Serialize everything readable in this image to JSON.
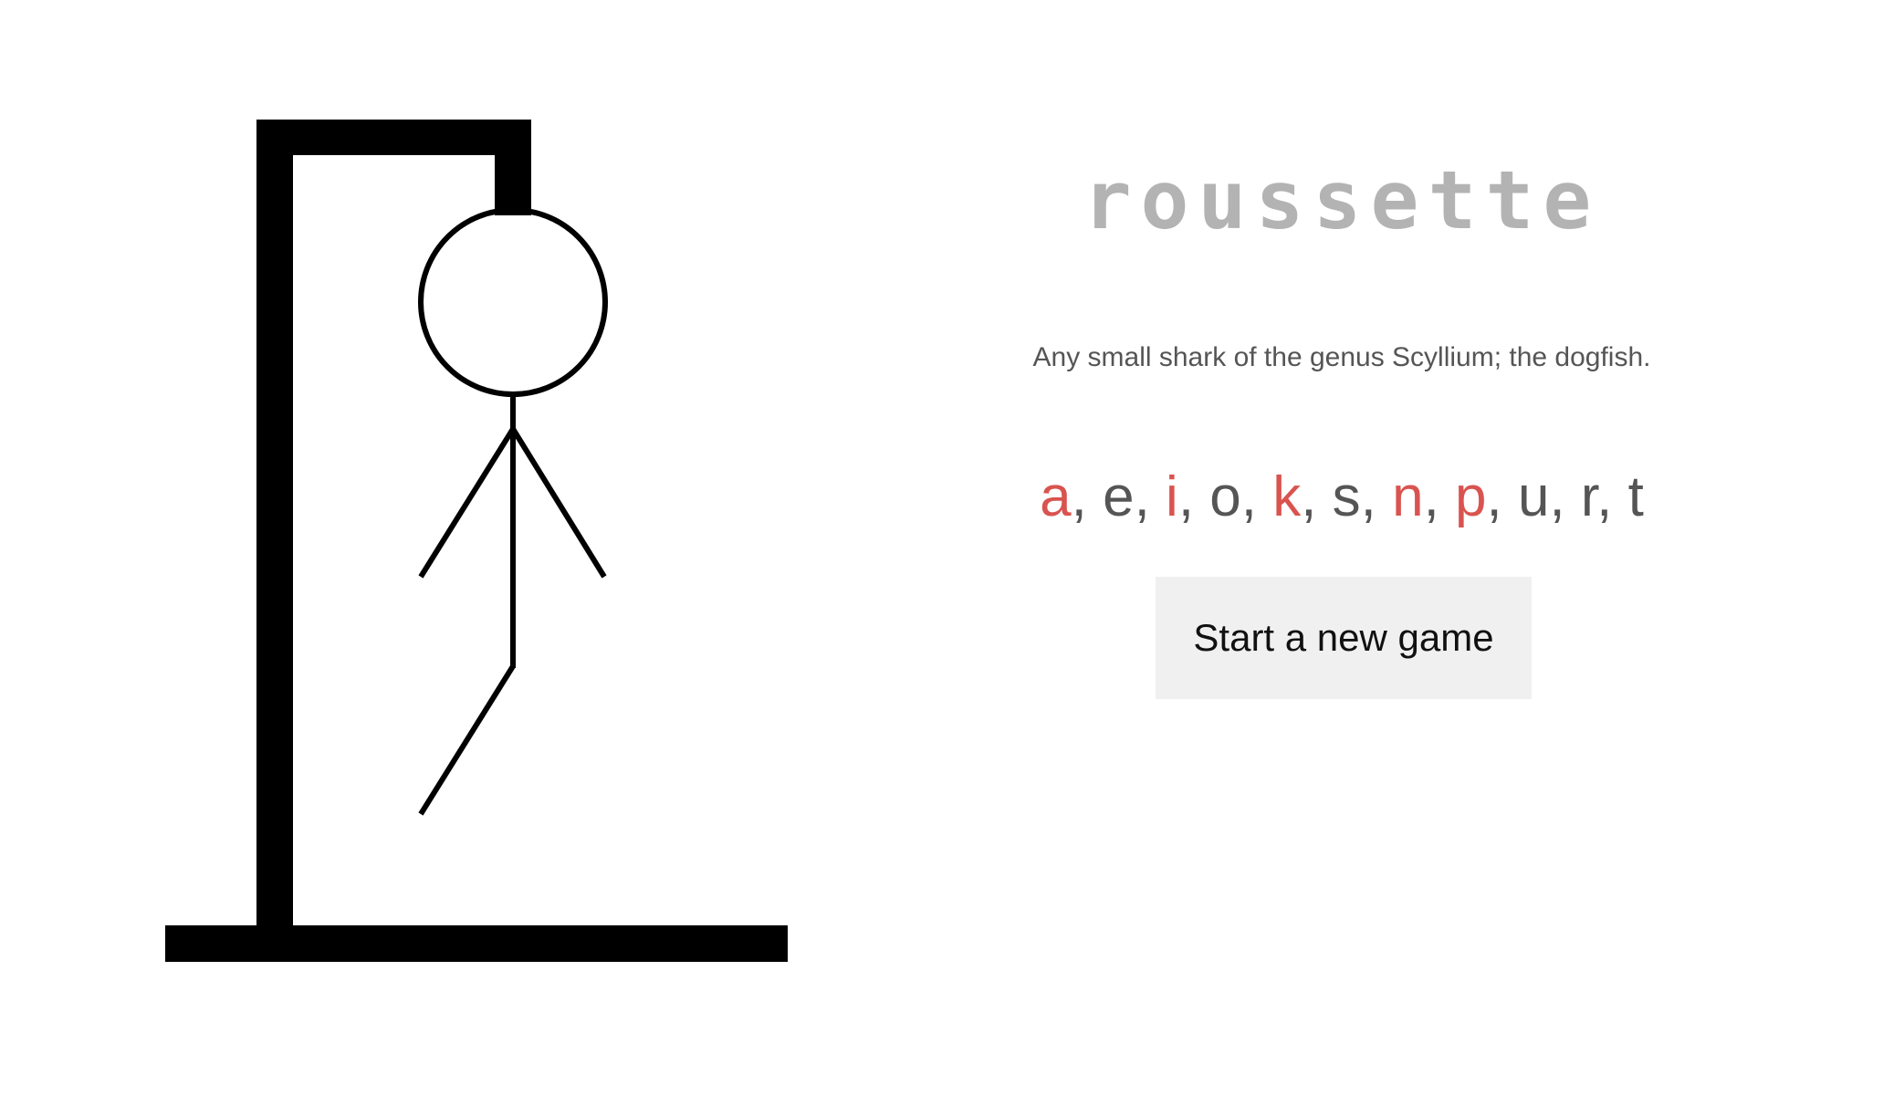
{
  "game": {
    "word": "roussette",
    "definition": "Any small shark of the genus Scyllium; the dogfish.",
    "wrong_guess_count": 5,
    "new_game_label": "Start a new game"
  },
  "guesses": [
    {
      "letter": "a",
      "status": "wrong"
    },
    {
      "letter": "e",
      "status": "right"
    },
    {
      "letter": "i",
      "status": "wrong"
    },
    {
      "letter": "o",
      "status": "right"
    },
    {
      "letter": "k",
      "status": "wrong"
    },
    {
      "letter": "s",
      "status": "right"
    },
    {
      "letter": "n",
      "status": "wrong"
    },
    {
      "letter": "p",
      "status": "wrong"
    },
    {
      "letter": "u",
      "status": "right"
    },
    {
      "letter": "r",
      "status": "right"
    },
    {
      "letter": "t",
      "status": "right"
    }
  ],
  "colors": {
    "wrong_guess": "#d9534f",
    "correct_guess": "#555555",
    "word": "#b3b3b3",
    "gallows": "#000000",
    "button_background": "#f0f0f0"
  }
}
